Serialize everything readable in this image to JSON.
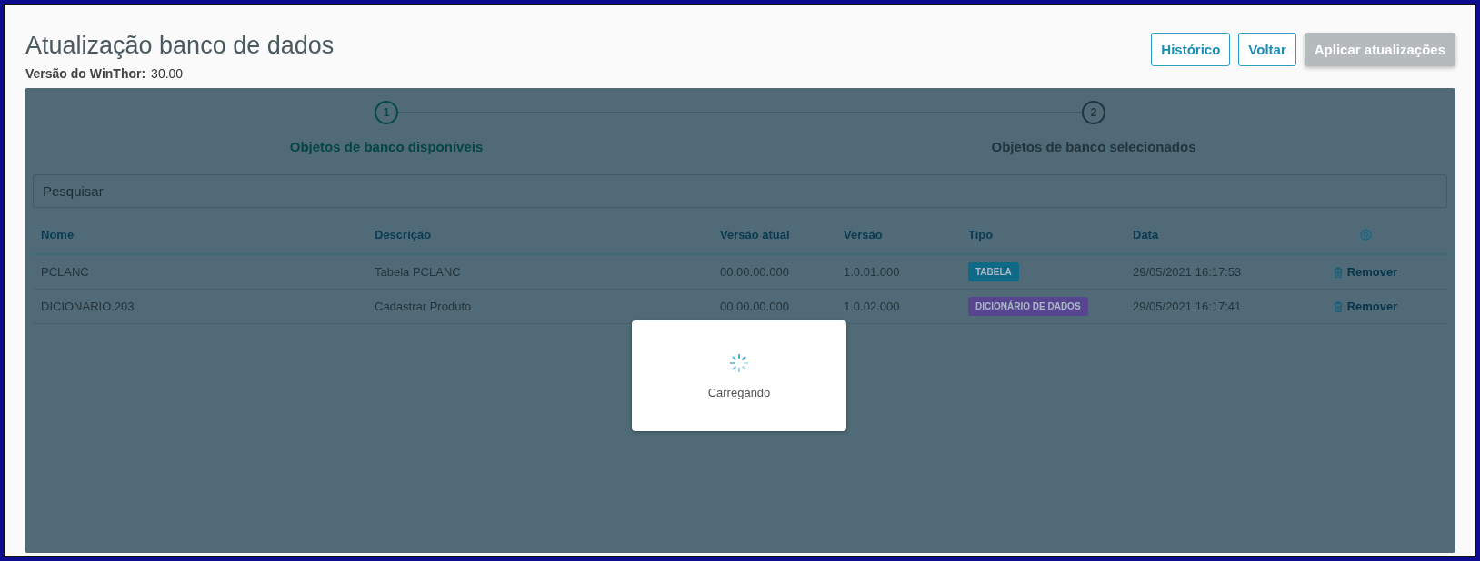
{
  "header": {
    "title": "Atualização banco de dados",
    "version_label": "Versão do WinThor:",
    "version_value": "30.00"
  },
  "buttons": [
    {
      "label": "Histórico",
      "disabled": false
    },
    {
      "label": "Voltar",
      "disabled": false
    },
    {
      "label": "Aplicar atualizações",
      "disabled": true
    }
  ],
  "steps": [
    {
      "number": "1",
      "label": "Objetos de banco disponíveis",
      "selected": true
    },
    {
      "number": "2",
      "label": "Objetos de banco selecionados",
      "selected": false
    }
  ],
  "search": {
    "placeholder": "Pesquisar"
  },
  "table": {
    "columns": [
      "Nome",
      "Descrição",
      "Versão atual",
      "Versão",
      "Tipo",
      "Data"
    ],
    "rows": [
      {
        "nome": "PCLANC",
        "descricao": "Tabela PCLANC",
        "versao_atual": "00.00.00.000",
        "versao": "1.0.01.000",
        "tipo": {
          "label": "TABELA",
          "color": "#0e6a86"
        },
        "data": "29/05/2021 16:17:53",
        "action": "Remover"
      },
      {
        "nome": "DICIONARIO.203",
        "descricao": "Cadastrar Produto",
        "versao_atual": "00.00.00.000",
        "versao": "1.0.02.000",
        "tipo": {
          "label": "DICIONÁRIO DE DADOS",
          "color": "#57468f"
        },
        "data": "29/05/2021 16:17:41",
        "action": "Remover"
      }
    ]
  },
  "loading": {
    "text": "Carregando"
  }
}
